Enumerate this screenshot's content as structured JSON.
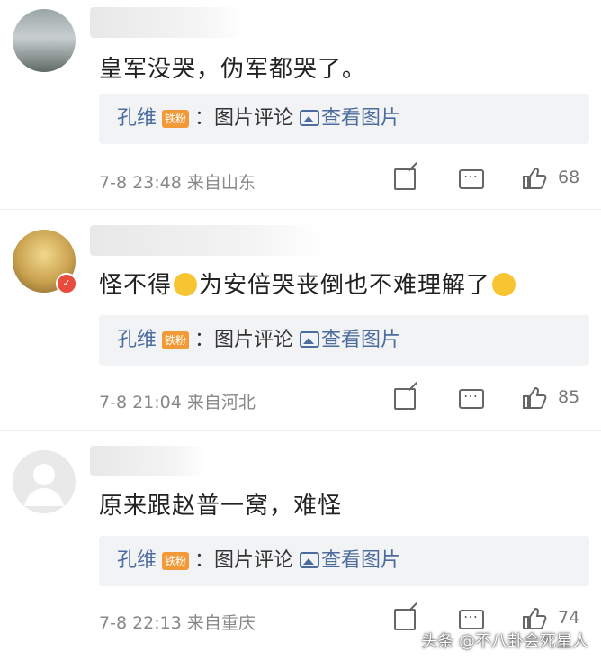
{
  "comments": [
    {
      "text": "皇军没哭，伪军都哭了。",
      "reply": {
        "user": "孔维",
        "level": "铁粉",
        "label": "：图片评论",
        "pic_link": "查看图片"
      },
      "meta": "7-8 23:48  来自山东",
      "likes": "68"
    },
    {
      "text_a": "怪不得",
      "text_b": "为安倍哭丧倒也不难理解了",
      "reply": {
        "user": "孔维",
        "level": "铁粉",
        "label": "：图片评论",
        "pic_link": "查看图片"
      },
      "meta": "7-8 21:04  来自河北",
      "likes": "85"
    },
    {
      "text": "原来跟赵普一窝，难怪",
      "reply": {
        "user": "孔维",
        "level": "铁粉",
        "label": "：图片评论",
        "pic_link": "查看图片"
      },
      "meta": "7-8 22:13  来自重庆",
      "likes": "74"
    }
  ],
  "watermark": "头条 @不八卦会死星人",
  "icons": {
    "share": "share-icon",
    "comment": "comment-icon",
    "like": "thumbs-up-icon",
    "picture": "picture-icon"
  },
  "colors": {
    "link": "#4c6c9e",
    "level_badge": "#f29a38",
    "reply_bg": "#f2f3f5",
    "meta": "#888888"
  }
}
